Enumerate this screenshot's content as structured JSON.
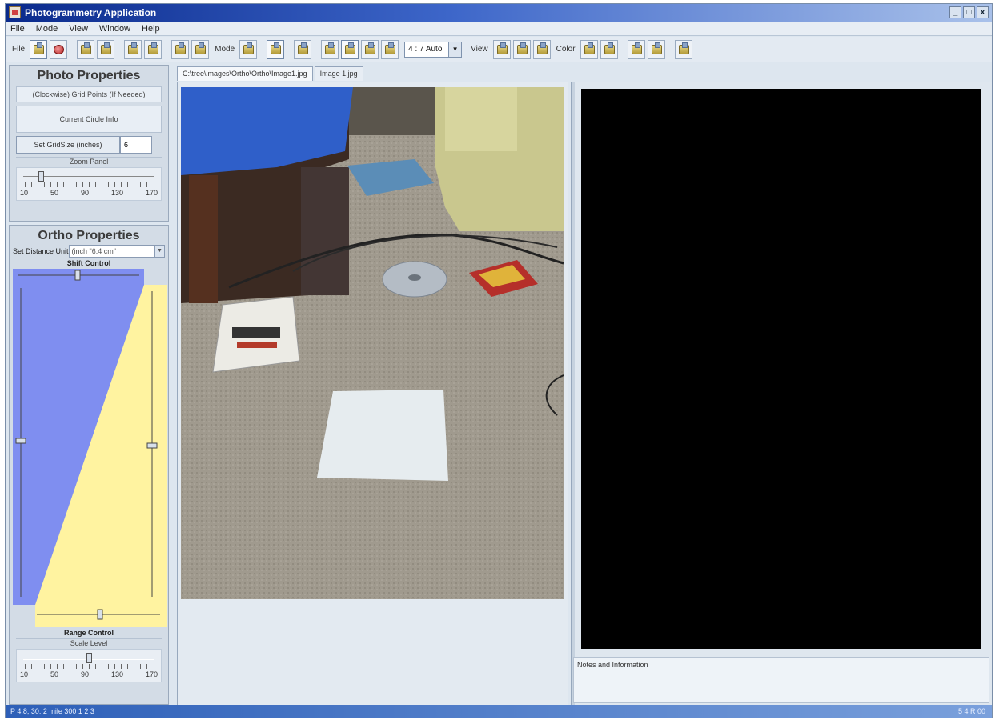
{
  "window": {
    "title": "Photogrammetry Application",
    "buttons": [
      "_",
      "□",
      "x"
    ]
  },
  "menu": [
    "File",
    "Mode",
    "View",
    "Window",
    "Help"
  ],
  "toolbar": {
    "file_label": "File",
    "mode_label": "Mode",
    "view_label": "View",
    "color_label": "Color",
    "zoom_select": "4 : 7 Auto"
  },
  "photo_properties": {
    "title": "Photo Properties",
    "info_line": "(Clockwise) Grid Points (If Needed)",
    "current_circle_info": "Current Circle Info",
    "set_gridsize_button": "Set GridSize (inches)",
    "gridsize_value": "6",
    "zoom_panel_label": "Zoom Panel",
    "zoom_ticks": [
      "10",
      "50",
      "90",
      "130",
      "170"
    ],
    "zoom_value": 30
  },
  "ortho_properties": {
    "title": "Ortho Properties",
    "distance_label": "Set Distance Unit",
    "distance_value": "(inch \"6.4 cm\"",
    "shift_control_label": "Shift Control",
    "range_control_label": "Range Control",
    "scale_label": "Scale Level",
    "scale_ticks": [
      "10",
      "50",
      "90",
      "130",
      "170"
    ],
    "scale_value": 90
  },
  "tabs": [
    "C:\\tree\\images\\Ortho\\Ortho\\Image1.jpg",
    "Image 1.jpg"
  ],
  "notes": {
    "label": "Notes and Information"
  },
  "statusbar": {
    "left": "P 4.8, 30: 2 mile 300 1 2 3",
    "right": "5 4 R 00"
  },
  "colors": {
    "ortho_blue": "#7f8ef0",
    "ortho_yellow": "#fff3a0",
    "title_gradient_start": "#0a2a8c"
  }
}
